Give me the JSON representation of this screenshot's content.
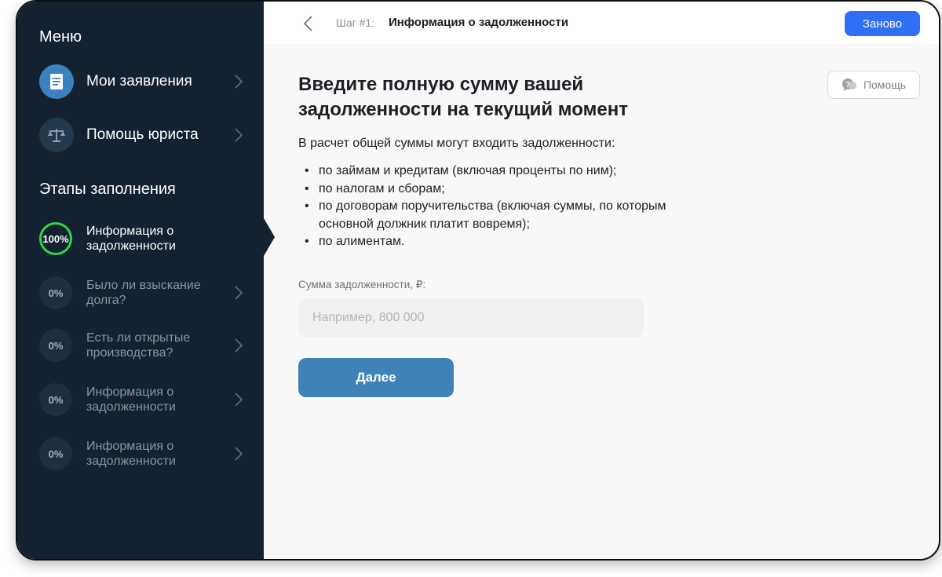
{
  "sidebar": {
    "menu_title": "Меню",
    "menu_items": [
      {
        "label": "Мои заявления",
        "icon": "document-icon"
      },
      {
        "label": "Помощь юриста",
        "icon": "scales-icon"
      }
    ],
    "steps_title": "Этапы заполнения",
    "steps": [
      {
        "percent": "100%",
        "label": "Информация о задолженности",
        "status": "active"
      },
      {
        "percent": "0%",
        "label": "Было ли взыскание долга?",
        "status": "pending"
      },
      {
        "percent": "0%",
        "label": "Есть ли открытые производства?",
        "status": "pending"
      },
      {
        "percent": "0%",
        "label": "Информация о задолженности",
        "status": "pending"
      },
      {
        "percent": "0%",
        "label": "Информация о задолженности",
        "status": "pending"
      }
    ]
  },
  "header": {
    "step_number": "Шаг #1:",
    "step_title": "Информация о задолженности",
    "restart_label": "Заново"
  },
  "main": {
    "help_label": "Помощь",
    "heading": "Введите полную сумму вашей задолженности на текущий момент",
    "intro": "В расчет общей суммы могут входить задолженности:",
    "bullets": [
      "по займам и кредитам (включая проценты по ним);",
      "по налогам и сборам;",
      "по договорам поручительства (включая суммы, по которым основной должник платит вовремя);",
      "по алиментам."
    ],
    "amount_label": "Сумма задолженности, ₽:",
    "amount_placeholder": "Например, 800 000",
    "amount_value": "",
    "next_label": "Далее"
  },
  "colors": {
    "sidebar_bg": "#132131",
    "accent_blue": "#2f6ef5",
    "next_button": "#3e82b8",
    "progress_green": "#2fd44a",
    "menu_icon_blue": "#3a82bf",
    "menu_icon_dark": "#25384c"
  }
}
